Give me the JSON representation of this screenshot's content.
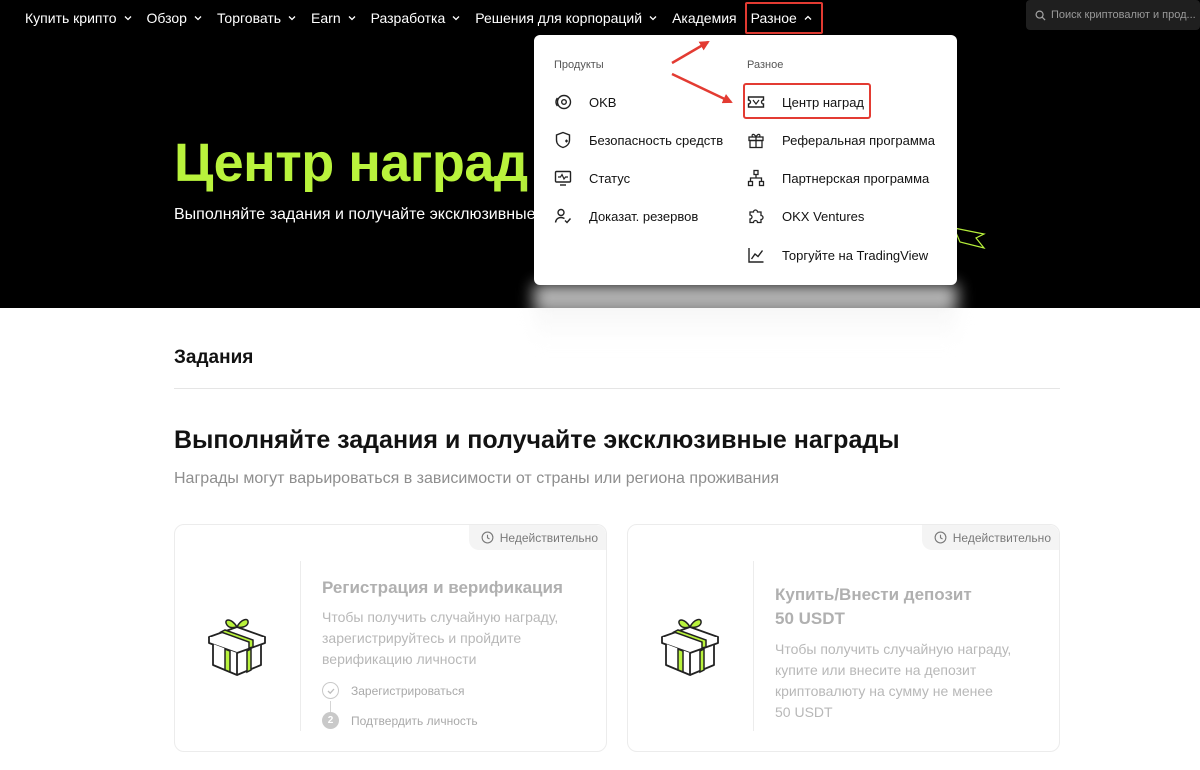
{
  "nav": {
    "items": [
      {
        "label": "Купить крипто",
        "chevron": true
      },
      {
        "label": "Обзор",
        "chevron": true
      },
      {
        "label": "Торговать",
        "chevron": true
      },
      {
        "label": "Earn",
        "chevron": true
      },
      {
        "label": "Разработка",
        "chevron": true
      },
      {
        "label": "Решения для корпораций",
        "chevron": true
      },
      {
        "label": "Академия",
        "chevron": false
      },
      {
        "label": "Разное",
        "chevron": true,
        "active": true
      }
    ],
    "search_placeholder": "Поиск криптовалют и прод..."
  },
  "hero": {
    "title": "Центр наград",
    "subtitle": "Выполняйте задания и получайте эксклюзивные"
  },
  "dropdown": {
    "left_heading": "Продукты",
    "right_heading": "Разное",
    "left_items": [
      {
        "label": "OKB",
        "icon": "okb-coin-icon"
      },
      {
        "label": "Безопасность средств",
        "icon": "shield-icon"
      },
      {
        "label": "Статус",
        "icon": "monitor-pulse-icon"
      },
      {
        "label": "Доказат. резервов",
        "icon": "user-check-icon"
      }
    ],
    "right_items": [
      {
        "label": "Центр наград",
        "icon": "ticket-icon"
      },
      {
        "label": "Реферальная программа",
        "icon": "gift-icon"
      },
      {
        "label": "Партнерская программа",
        "icon": "network-icon"
      },
      {
        "label": "OKX Ventures",
        "icon": "puzzle-icon"
      },
      {
        "label": "Торгуйте на TradingView",
        "icon": "chart-line-icon"
      }
    ]
  },
  "section": {
    "tab": "Задания",
    "title": "Выполняйте задания и получайте эксклюзивные награды",
    "subtitle": "Награды могут варьироваться в зависимости от страны или региона проживания"
  },
  "cards": [
    {
      "badge": "Недействительно",
      "title_lines": [
        "Регистрация и верификация"
      ],
      "desc_lines": [
        "Чтобы получить случайную награду,",
        "зарегистрируйтесь и пройдите",
        "верификацию личности"
      ],
      "steps": [
        {
          "label": "Зарегистрироваться",
          "marker": "check"
        },
        {
          "label": "Подтвердить личность",
          "marker": "2"
        }
      ]
    },
    {
      "badge": "Недействительно",
      "title_lines": [
        "Купить/Внести депозит",
        "50 USDT"
      ],
      "desc_lines": [
        "Чтобы получить случайную награду,",
        "купите или внесите на депозит",
        "криптовалюту на сумму не менее",
        "50 USDT"
      ],
      "steps": []
    }
  ],
  "colors": {
    "accent_green": "#b9f33c",
    "highlight_red": "#e33b32"
  }
}
